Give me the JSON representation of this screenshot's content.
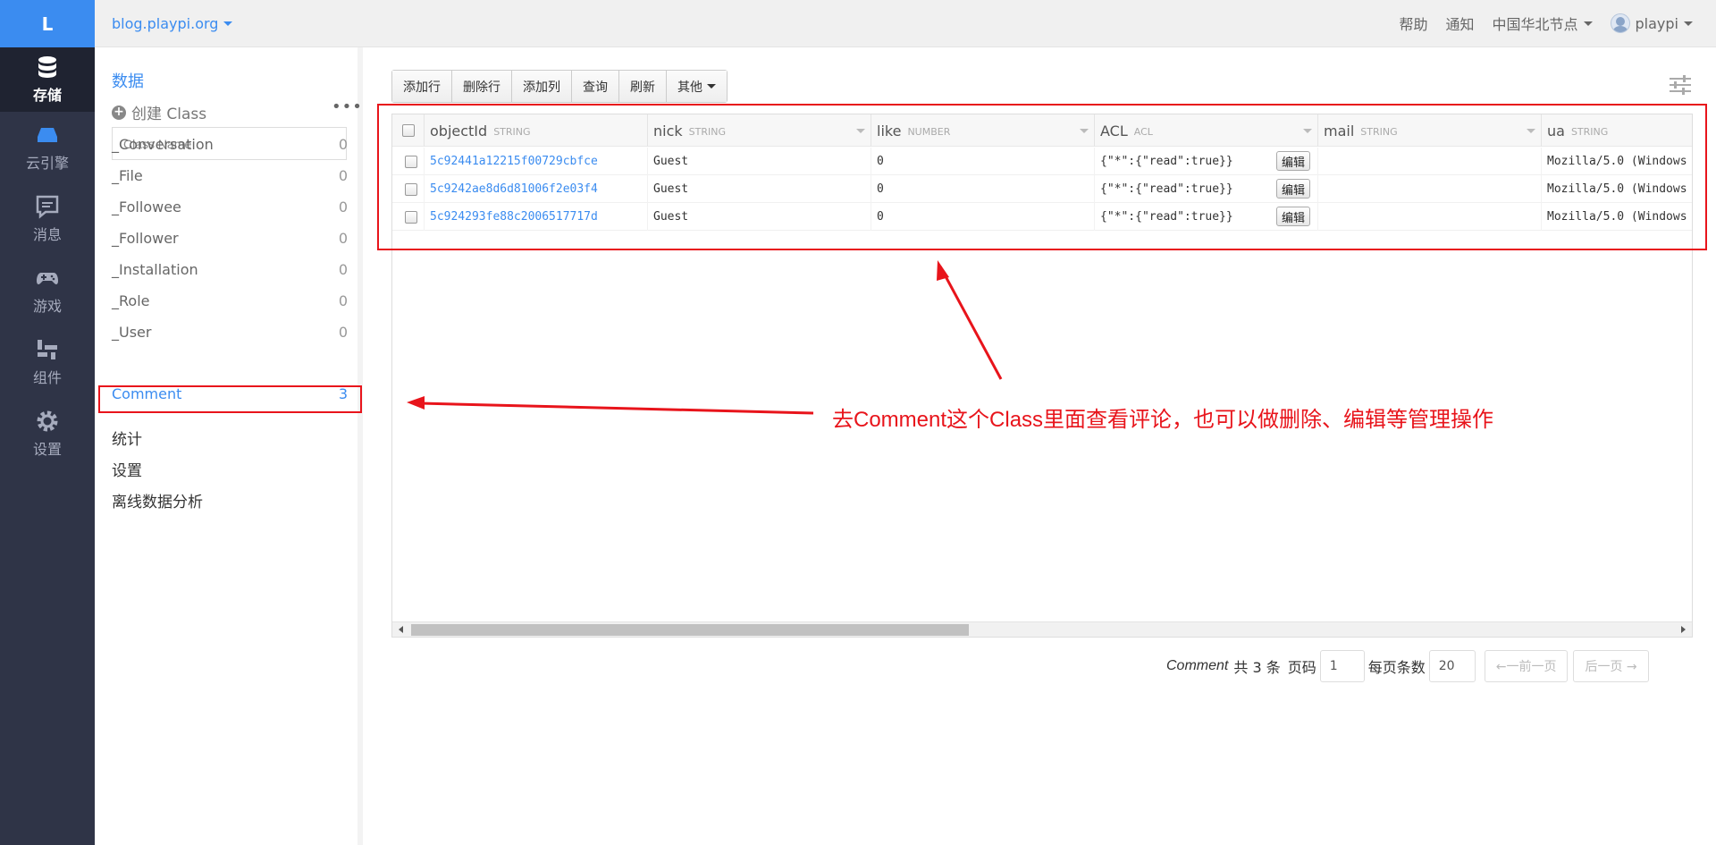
{
  "app": {
    "logo": "L",
    "nav": [
      {
        "label": "存储",
        "icon": "database-icon",
        "active": true
      },
      {
        "label": "云引擎",
        "icon": "engine-icon"
      },
      {
        "label": "消息",
        "icon": "message-icon"
      },
      {
        "label": "游戏",
        "icon": "gamepad-icon"
      },
      {
        "label": "组件",
        "icon": "components-icon"
      },
      {
        "label": "设置",
        "icon": "gear-icon"
      }
    ]
  },
  "topbar": {
    "site": "blog.playpi.org",
    "help": "帮助",
    "notify": "通知",
    "region": "中国华北节点",
    "user": "playpi"
  },
  "sidebar": {
    "title": "数据",
    "create_class": "创建 Class",
    "more": "•••",
    "search_placeholder": "Class Name",
    "classes": [
      {
        "name": "_Conversation",
        "count": "0"
      },
      {
        "name": "_File",
        "count": "0"
      },
      {
        "name": "_Followee",
        "count": "0"
      },
      {
        "name": "_Follower",
        "count": "0"
      },
      {
        "name": "_Installation",
        "count": "0"
      },
      {
        "name": "_Role",
        "count": "0"
      },
      {
        "name": "_User",
        "count": "0"
      },
      {
        "name": "Comment",
        "count": "3",
        "active": true
      }
    ],
    "links": [
      "统计",
      "设置",
      "离线数据分析"
    ]
  },
  "toolbar": {
    "add_row": "添加行",
    "delete_row": "删除行",
    "add_col": "添加列",
    "query": "查询",
    "refresh": "刷新",
    "other": "其他"
  },
  "table": {
    "columns": [
      {
        "name": "objectId",
        "type": "STRING"
      },
      {
        "name": "nick",
        "type": "STRING"
      },
      {
        "name": "like",
        "type": "NUMBER"
      },
      {
        "name": "ACL",
        "type": "ACL"
      },
      {
        "name": "mail",
        "type": "STRING"
      },
      {
        "name": "ua",
        "type": "STRING"
      }
    ],
    "edit_label": "编辑",
    "rows": [
      {
        "objectId": "5c92441a12215f00729cbfce",
        "nick": "Guest",
        "like": "0",
        "acl": "{\"*\":{\"read\":true}}",
        "mail": "",
        "ua": "Mozilla/5.0 (Windows"
      },
      {
        "objectId": "5c9242ae8d6d81006f2e03f4",
        "nick": "Guest",
        "like": "0",
        "acl": "{\"*\":{\"read\":true}}",
        "mail": "",
        "ua": "Mozilla/5.0 (Windows"
      },
      {
        "objectId": "5c924293fe88c2006517717d",
        "nick": "Guest",
        "like": "0",
        "acl": "{\"*\":{\"read\":true}}",
        "mail": "",
        "ua": "Mozilla/5.0 (Windows"
      }
    ]
  },
  "pagination": {
    "class_name": "Comment",
    "total": "共 3 条",
    "page_label": "页码",
    "page": "1",
    "per_page_label": "每页条数",
    "per_page": "20",
    "prev": "←一前一页",
    "next": "后一页 →"
  },
  "annotation": {
    "text": "去Comment这个Class里面查看评论，也可以做删除、编辑等管理操作",
    "color": "#e8141b"
  },
  "colors": {
    "accent": "#3b8cf0",
    "nav_bg": "#2f3447"
  }
}
